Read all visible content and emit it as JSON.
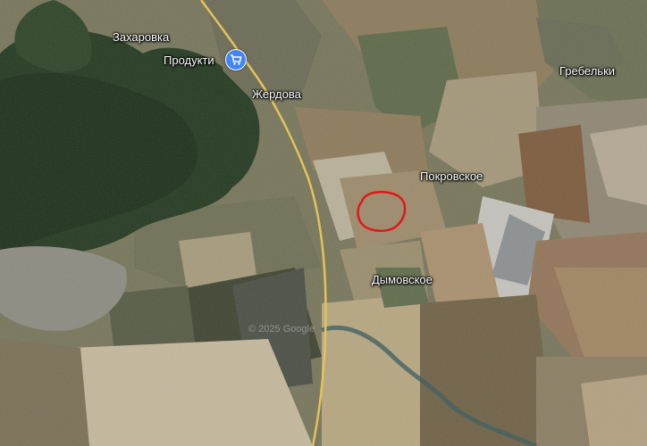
{
  "map": {
    "type": "satellite",
    "places": {
      "zakharovka": "Захаровка",
      "zherdova": "Жердова",
      "grebelki": "Гребельки",
      "pokrovskoe": "Покровское",
      "dymovskoe": "Дымовское"
    },
    "poi": {
      "label": "Продукти",
      "icon": "shopping-cart-icon",
      "color": "#4285f4"
    },
    "highlight": {
      "shape": "hand-drawn-loop",
      "color": "#e3161b"
    },
    "road_color": "#e3c25a",
    "watermark": "© 2025 Google"
  }
}
